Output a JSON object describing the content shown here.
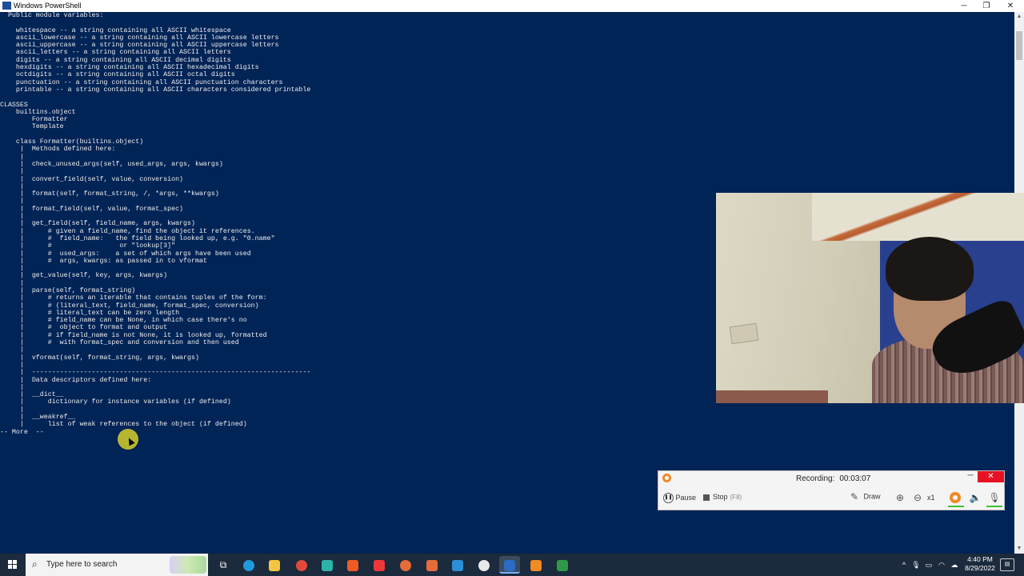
{
  "window": {
    "title": "Windows PowerShell",
    "minimize_glyph": "─",
    "maximize_glyph": "❐",
    "close_glyph": "✕"
  },
  "console": {
    "lines": [
      "  Public module variables:",
      "",
      "    whitespace -- a string containing all ASCII whitespace",
      "    ascii_lowercase -- a string containing all ASCII lowercase letters",
      "    ascii_uppercase -- a string containing all ASCII uppercase letters",
      "    ascii_letters -- a string containing all ASCII letters",
      "    digits -- a string containing all ASCII decimal digits",
      "    hexdigits -- a string containing all ASCII hexadecimal digits",
      "    octdigits -- a string containing all ASCII octal digits",
      "    punctuation -- a string containing all ASCII punctuation characters",
      "    printable -- a string containing all ASCII characters considered printable",
      "",
      "CLASSES",
      "    builtins.object",
      "        Formatter",
      "        Template",
      "",
      "    class Formatter(builtins.object)",
      "     |  Methods defined here:",
      "     |",
      "     |  check_unused_args(self, used_args, args, kwargs)",
      "     |",
      "     |  convert_field(self, value, conversion)",
      "     |",
      "     |  format(self, format_string, /, *args, **kwargs)",
      "     |",
      "     |  format_field(self, value, format_spec)",
      "     |",
      "     |  get_field(self, field_name, args, kwargs)",
      "     |      # given a field_name, find the object it references.",
      "     |      #  field_name:   the field being looked up, e.g. \"0.name\"",
      "     |      #                 or \"lookup[3]\"",
      "     |      #  used_args:    a set of which args have been used",
      "     |      #  args, kwargs: as passed in to vformat",
      "     |",
      "     |  get_value(self, key, args, kwargs)",
      "     |",
      "     |  parse(self, format_string)",
      "     |      # returns an iterable that contains tuples of the form:",
      "     |      # (literal_text, field_name, format_spec, conversion)",
      "     |      # literal_text can be zero length",
      "     |      # field_name can be None, in which case there's no",
      "     |      #  object to format and output",
      "     |      # if field_name is not None, it is looked up, formatted",
      "     |      #  with format_spec and conversion and then used",
      "     |",
      "     |  vformat(self, format_string, args, kwargs)",
      "     |",
      "     |  ----------------------------------------------------------------------",
      "     |  Data descriptors defined here:",
      "     |",
      "     |  __dict__",
      "     |      dictionary for instance variables (if defined)",
      "     |",
      "     |  __weakref__",
      "     |      list of weak references to the object (if defined)",
      "-- More  --"
    ]
  },
  "recorder": {
    "status_label": "Recording:",
    "elapsed": "00:03:07",
    "pause_label": "Pause",
    "stop_label": "Stop",
    "stop_hint": "(F8)",
    "draw_label": "Draw",
    "zoom_level": "x1",
    "minimize_glyph": "─",
    "close_glyph": "✕"
  },
  "taskbar": {
    "search_placeholder": "Type here to search",
    "clock_time": "4:40 PM",
    "clock_date": "8/29/2022",
    "apps": [
      {
        "name": "task-view-icon",
        "glyph": "⧉",
        "color": "#ffffff"
      },
      {
        "name": "edge-icon",
        "glyph": "",
        "color": "#1f9bdc"
      },
      {
        "name": "file-explorer-icon",
        "glyph": "",
        "color": "#f4c542"
      },
      {
        "name": "chrome-icon",
        "glyph": "",
        "color": "#e04a3a"
      },
      {
        "name": "app-arrow-icon",
        "glyph": "",
        "color": "#2bb5a8"
      },
      {
        "name": "brave-icon",
        "glyph": "",
        "color": "#f05a24"
      },
      {
        "name": "vivaldi-icon",
        "glyph": "",
        "color": "#ef3939"
      },
      {
        "name": "chrome-profile-icon",
        "glyph": "",
        "color": "#e86b3a"
      },
      {
        "name": "app-grid-icon",
        "glyph": "",
        "color": "#e86b3a"
      },
      {
        "name": "vscode-icon",
        "glyph": "",
        "color": "#2a8fd8"
      },
      {
        "name": "obs-icon",
        "glyph": "",
        "color": "#e8e8e8"
      },
      {
        "name": "powershell-icon",
        "glyph": "",
        "color": "#2c6bc4"
      },
      {
        "name": "recorder-app-icon",
        "glyph": "",
        "color": "#f08a24"
      },
      {
        "name": "excel-like-icon",
        "glyph": "",
        "color": "#2e9a48"
      }
    ],
    "colors": {
      "bar": "#1b2a3c",
      "active_underline": "#7ab3f5"
    }
  },
  "colors": {
    "console_bg": "#012456",
    "console_fg": "#eeedf0",
    "cursor_highlight": "#ded628",
    "recorder_accent": "#f08a24",
    "close_red": "#e81123"
  }
}
